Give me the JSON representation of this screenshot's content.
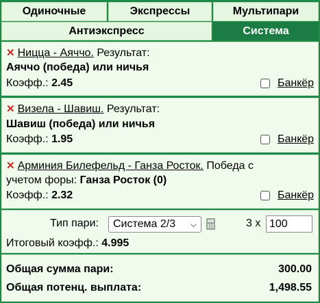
{
  "tabs": {
    "single": "Одиночные",
    "express": "Экспрессы",
    "multi": "Мультипари",
    "antiexpress": "Антиэкспресс",
    "system": "Система"
  },
  "bets": [
    {
      "event": "Ницца - Аяччо.",
      "desc": " Результат:",
      "pick": "Аяччо (победа) или ничья",
      "odds_label": "Коэфф.:",
      "odds": "2.45",
      "banker": "Банкёр"
    },
    {
      "event": "Визела - Шавиш.",
      "desc": " Результат:",
      "pick": "Шавиш (победа) или ничья",
      "odds_label": "Коэфф.:",
      "odds": "1.95",
      "banker": "Банкёр"
    },
    {
      "event": "Арминия Билефельд - Ганза Росток.",
      "desc": " Победа с",
      "desc2": "учетом форы: ",
      "pick": "Ганза Росток (0)",
      "odds_label": "Коэфф.:",
      "odds": "2.32",
      "banker": "Банкёр"
    }
  ],
  "system": {
    "type_label": "Тип пари:",
    "type_value": "Система 2/3",
    "multiplier": "3 x",
    "stake": "100",
    "total_odds_label": "Итоговый коэфф.:",
    "total_odds": "4.995"
  },
  "totals": {
    "sum_label": "Общая сумма пари:",
    "sum_value": "300.00",
    "payout_label": "Общая потенц. выплата:",
    "payout_value": "1,498.55"
  },
  "colors": {
    "active_tab": "#1b7d43",
    "inactive_tab": "#e6f7e1",
    "panel": "#f0fbee",
    "cross": "#c62828"
  }
}
